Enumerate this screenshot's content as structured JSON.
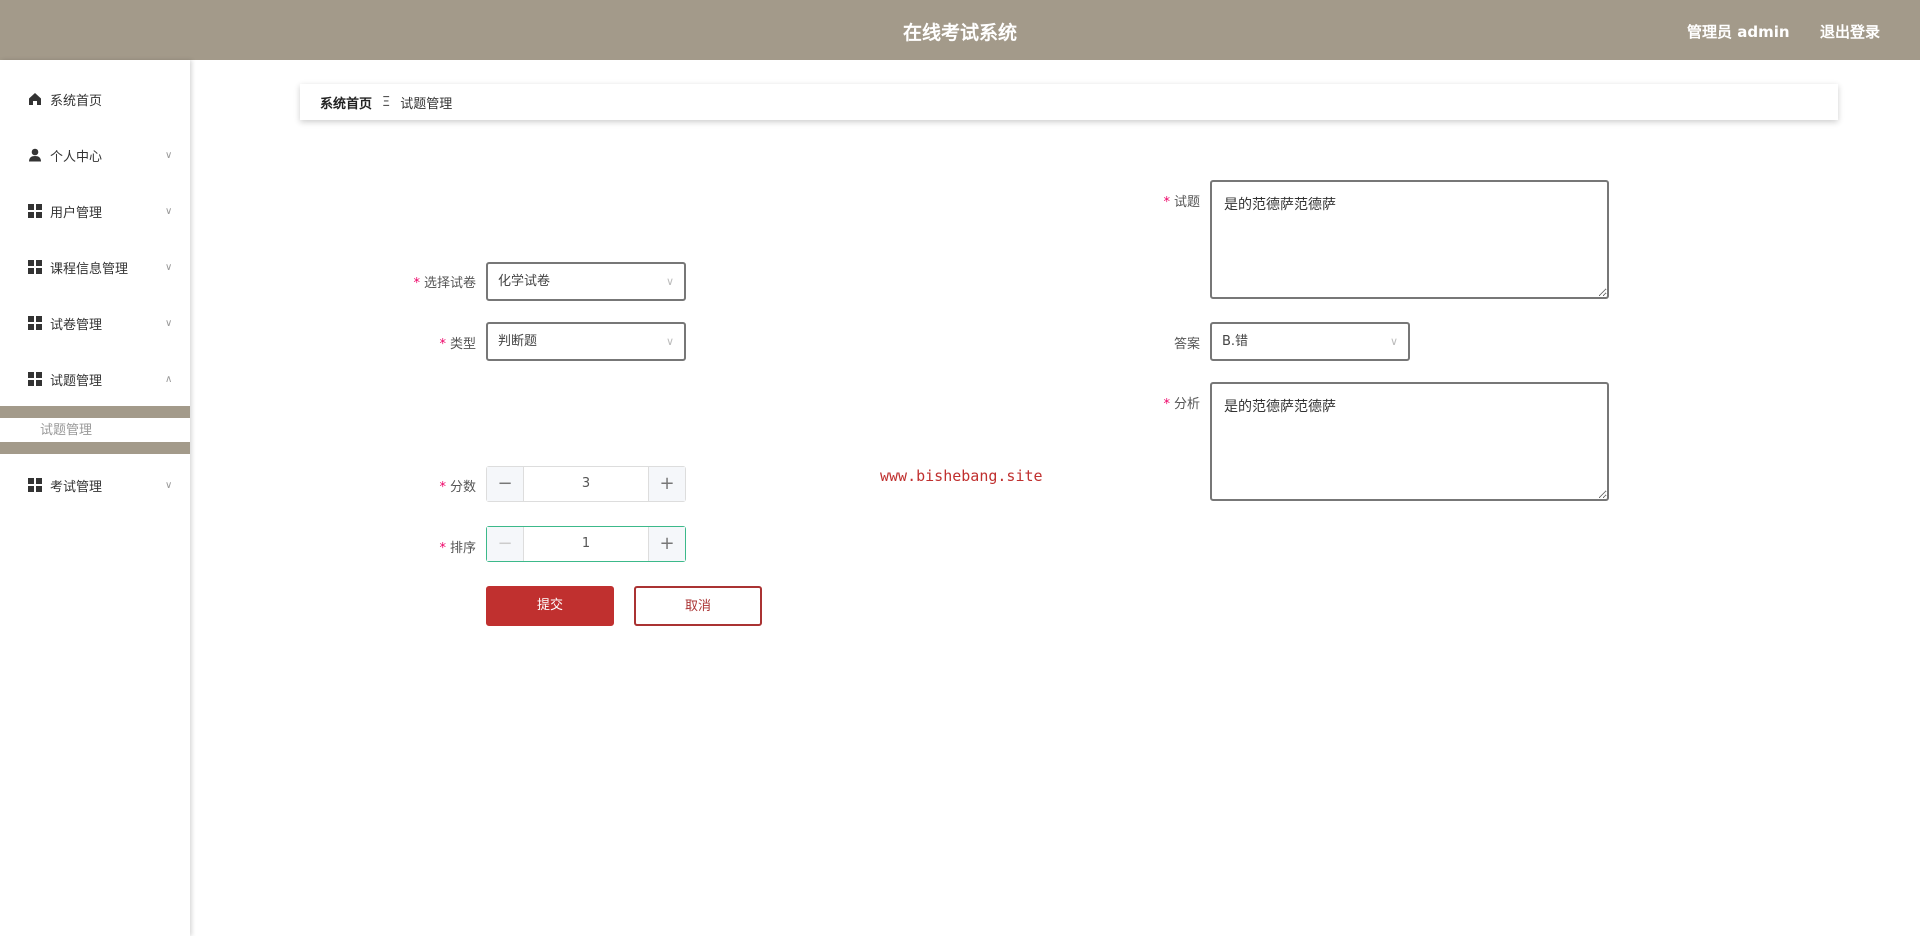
{
  "header": {
    "title": "在线考试系统",
    "user": "管理员 admin",
    "logout": "退出登录"
  },
  "sidebar": {
    "items": [
      {
        "label": "系统首页",
        "icon": "home-icon"
      },
      {
        "label": "个人中心",
        "icon": "user-icon"
      },
      {
        "label": "用户管理",
        "icon": "grid-icon"
      },
      {
        "label": "课程信息管理",
        "icon": "grid-icon"
      },
      {
        "label": "试卷管理",
        "icon": "grid-icon"
      },
      {
        "label": "试题管理",
        "icon": "grid-icon"
      },
      {
        "label": "考试管理",
        "icon": "grid-icon"
      }
    ],
    "submenu": "试题管理"
  },
  "breadcrumb": {
    "home": "系统首页",
    "sep": "Ξ",
    "current": "试题管理"
  },
  "form": {
    "paper": {
      "label": "选择试卷",
      "value": "化学试卷"
    },
    "type": {
      "label": "类型",
      "value": "判断题"
    },
    "score": {
      "label": "分数",
      "value": "3"
    },
    "order": {
      "label": "排序",
      "value": "1"
    },
    "question": {
      "label": "试题",
      "value": "是的范德萨范德萨"
    },
    "answer": {
      "label": "答案",
      "value": "B.错"
    },
    "analysis": {
      "label": "分析",
      "value": "是的范德萨范德萨"
    },
    "submit": "提交",
    "cancel": "取消"
  },
  "watermark": "www.bishebang.site"
}
